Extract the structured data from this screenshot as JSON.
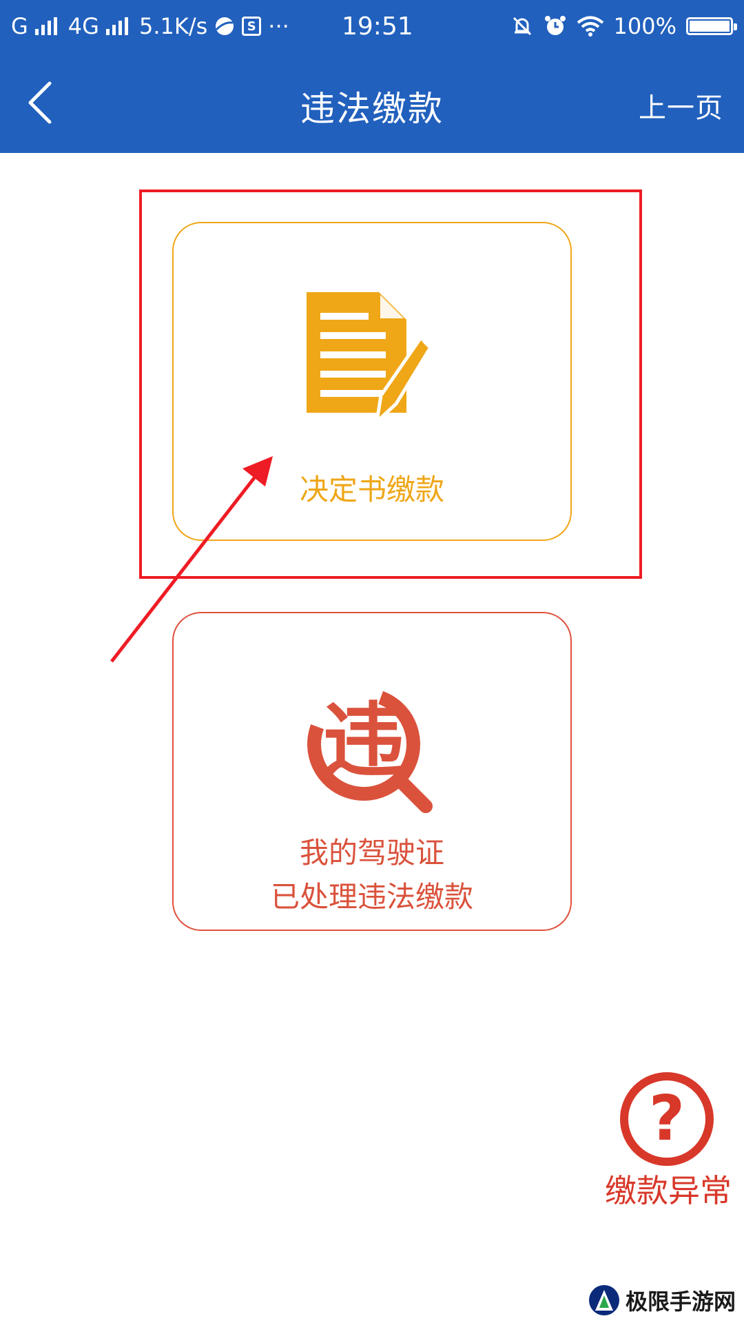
{
  "status_bar": {
    "carrier1": "G",
    "carrier2": "4G",
    "speed": "5.1K/s",
    "sim_glyph": "S",
    "more": "···",
    "time": "19:51",
    "battery_text": "100%",
    "battery_level": 1.0
  },
  "nav": {
    "title": "违法缴款",
    "prev_label": "上一页"
  },
  "cards": {
    "decision": {
      "label": "决定书缴款"
    },
    "violation": {
      "label_line1": "我的驾驶证",
      "label_line2": "已处理违法缴款",
      "icon_glyph": "违"
    }
  },
  "help": {
    "label": "缴款异常",
    "glyph": "?"
  },
  "watermark": {
    "text": "极限手游网"
  },
  "colors": {
    "header_blue": "#2160bd",
    "decision_orange": "#efa617",
    "violation_red": "#da523c",
    "help_red": "#d8382a",
    "annotation_red": "#ee1c24"
  }
}
